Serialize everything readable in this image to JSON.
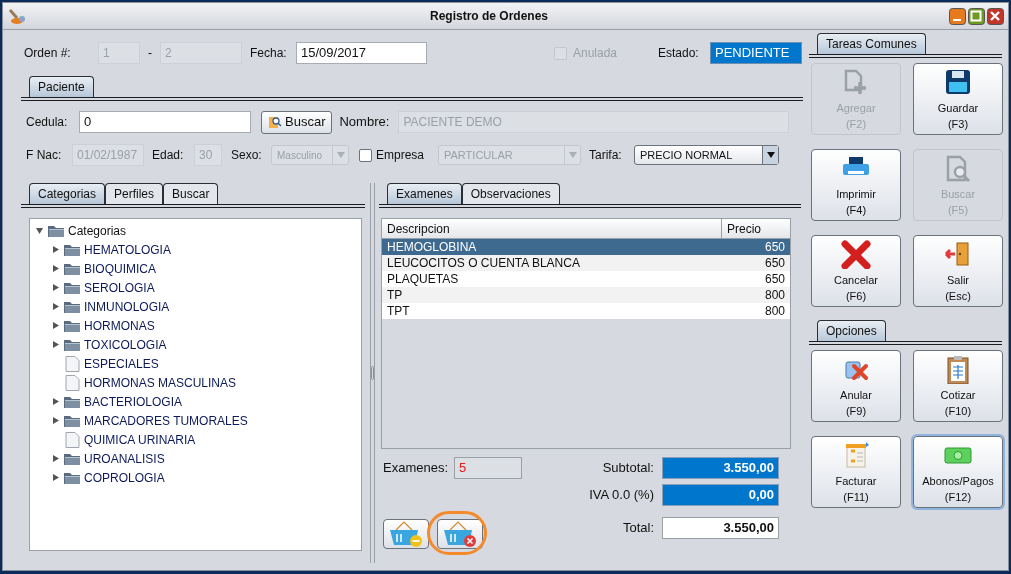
{
  "window": {
    "title": "Registro de Ordenes"
  },
  "header": {
    "orden_label": "Orden #:",
    "orden_serie": "1",
    "separator": "-",
    "orden_numero": "2",
    "fecha_label": "Fecha:",
    "fecha": "15/09/2017",
    "anulada": {
      "label": "Anulada",
      "checked": false,
      "disabled": true
    },
    "estado_label": "Estado:",
    "estado": "PENDIENTE"
  },
  "paciente_tabs": [
    {
      "label": "Paciente",
      "selected": true
    }
  ],
  "paciente": {
    "cedula_label": "Cedula:",
    "cedula": "0",
    "buscar_button": "Buscar",
    "nombre_label": "Nombre:",
    "nombre": "PACIENTE DEMO",
    "fnac_label": "F Nac:",
    "fnac": "01/02/1987",
    "edad_label": "Edad:",
    "edad": "30",
    "sexo_label": "Sexo:",
    "sexo": "Masculino",
    "empresa": {
      "label": "Empresa",
      "checked": false
    },
    "empresa_value": "PARTICULAR",
    "tarifa_label": "Tarifa:",
    "tarifa": "PRECIO NORMAL"
  },
  "left_tabs": [
    {
      "label": "Categorias",
      "selected": true
    },
    {
      "label": "Perfiles",
      "selected": false
    },
    {
      "label": "Buscar",
      "selected": false
    }
  ],
  "tree": {
    "label": "Categorias",
    "kind": "folder",
    "expanded": true,
    "children": [
      {
        "label": "HEMATOLOGIA",
        "kind": "folder",
        "expanded": false
      },
      {
        "label": "BIOQUIMICA",
        "kind": "folder",
        "expanded": false
      },
      {
        "label": "SEROLOGIA",
        "kind": "folder",
        "expanded": false
      },
      {
        "label": "INMUNOLOGIA",
        "kind": "folder",
        "expanded": false
      },
      {
        "label": "HORMONAS",
        "kind": "folder",
        "expanded": false
      },
      {
        "label": "TOXICOLOGIA",
        "kind": "folder",
        "expanded": false
      },
      {
        "label": "ESPECIALES",
        "kind": "file"
      },
      {
        "label": "HORMONAS MASCULINAS",
        "kind": "file"
      },
      {
        "label": "BACTERIOLOGIA",
        "kind": "folder",
        "expanded": false
      },
      {
        "label": "MARCADORES TUMORALES",
        "kind": "folder",
        "expanded": false
      },
      {
        "label": "QUIMICA URINARIA",
        "kind": "file"
      },
      {
        "label": "UROANALISIS",
        "kind": "folder",
        "expanded": false
      },
      {
        "label": "COPROLOGIA",
        "kind": "folder",
        "expanded": false
      }
    ]
  },
  "right_tabs": [
    {
      "label": "Examenes",
      "selected": true
    },
    {
      "label": "Observaciones",
      "selected": false
    }
  ],
  "table": {
    "columns": [
      "Descripcion",
      "Precio"
    ],
    "rows": [
      {
        "descripcion": "HEMOGLOBINA",
        "precio": "650",
        "selected": true
      },
      {
        "descripcion": "LEUCOCITOS O CUENTA BLANCA",
        "precio": "650",
        "selected": false
      },
      {
        "descripcion": "PLAQUETAS",
        "precio": "650",
        "selected": false
      },
      {
        "descripcion": "TP",
        "precio": "800",
        "selected": false
      },
      {
        "descripcion": "TPT",
        "precio": "800",
        "selected": false
      }
    ]
  },
  "summary": {
    "examenes_label": "Examenes:",
    "examenes": "5",
    "subtotal_label": "Subtotal:",
    "subtotal": "3.550,00",
    "iva_label": "IVA 0.0 (%)",
    "iva": "0,00",
    "total_label": "Total:",
    "total": "3.550,00"
  },
  "basket_buttons": [
    {
      "kind": "remove",
      "highlighted": false
    },
    {
      "kind": "delete",
      "highlighted": true
    }
  ],
  "tareas_tabs": [
    {
      "label": "Tareas Comunes",
      "selected": true
    }
  ],
  "tareas": [
    {
      "label": "Agregar",
      "shortcut": "(F2)",
      "kind": "add",
      "disabled": true,
      "focused": false
    },
    {
      "label": "Guardar",
      "shortcut": "(F3)",
      "kind": "save",
      "disabled": false,
      "focused": false
    },
    {
      "label": "Imprimir",
      "shortcut": "(F4)",
      "kind": "print",
      "disabled": false,
      "focused": false
    },
    {
      "label": "Buscar",
      "shortcut": "(F5)",
      "kind": "find",
      "disabled": true,
      "focused": false
    },
    {
      "label": "Cancelar",
      "shortcut": "(F6)",
      "kind": "cancel",
      "disabled": false,
      "focused": false
    },
    {
      "label": "Salir",
      "shortcut": "(Esc)",
      "kind": "exit",
      "disabled": false,
      "focused": false
    }
  ],
  "opciones_tabs": [
    {
      "label": "Opciones",
      "selected": true
    }
  ],
  "opciones": [
    {
      "label": "Anular",
      "shortcut": "(F9)",
      "kind": "void",
      "disabled": false,
      "focused": false
    },
    {
      "label": "Cotizar",
      "shortcut": "(F10)",
      "kind": "quote",
      "disabled": false,
      "focused": false
    },
    {
      "label": "Facturar",
      "shortcut": "(F11)",
      "kind": "invoice",
      "disabled": false,
      "focused": false
    },
    {
      "label": "Abonos/Pagos",
      "shortcut": "(F12)",
      "kind": "money",
      "disabled": false,
      "focused": true
    }
  ]
}
